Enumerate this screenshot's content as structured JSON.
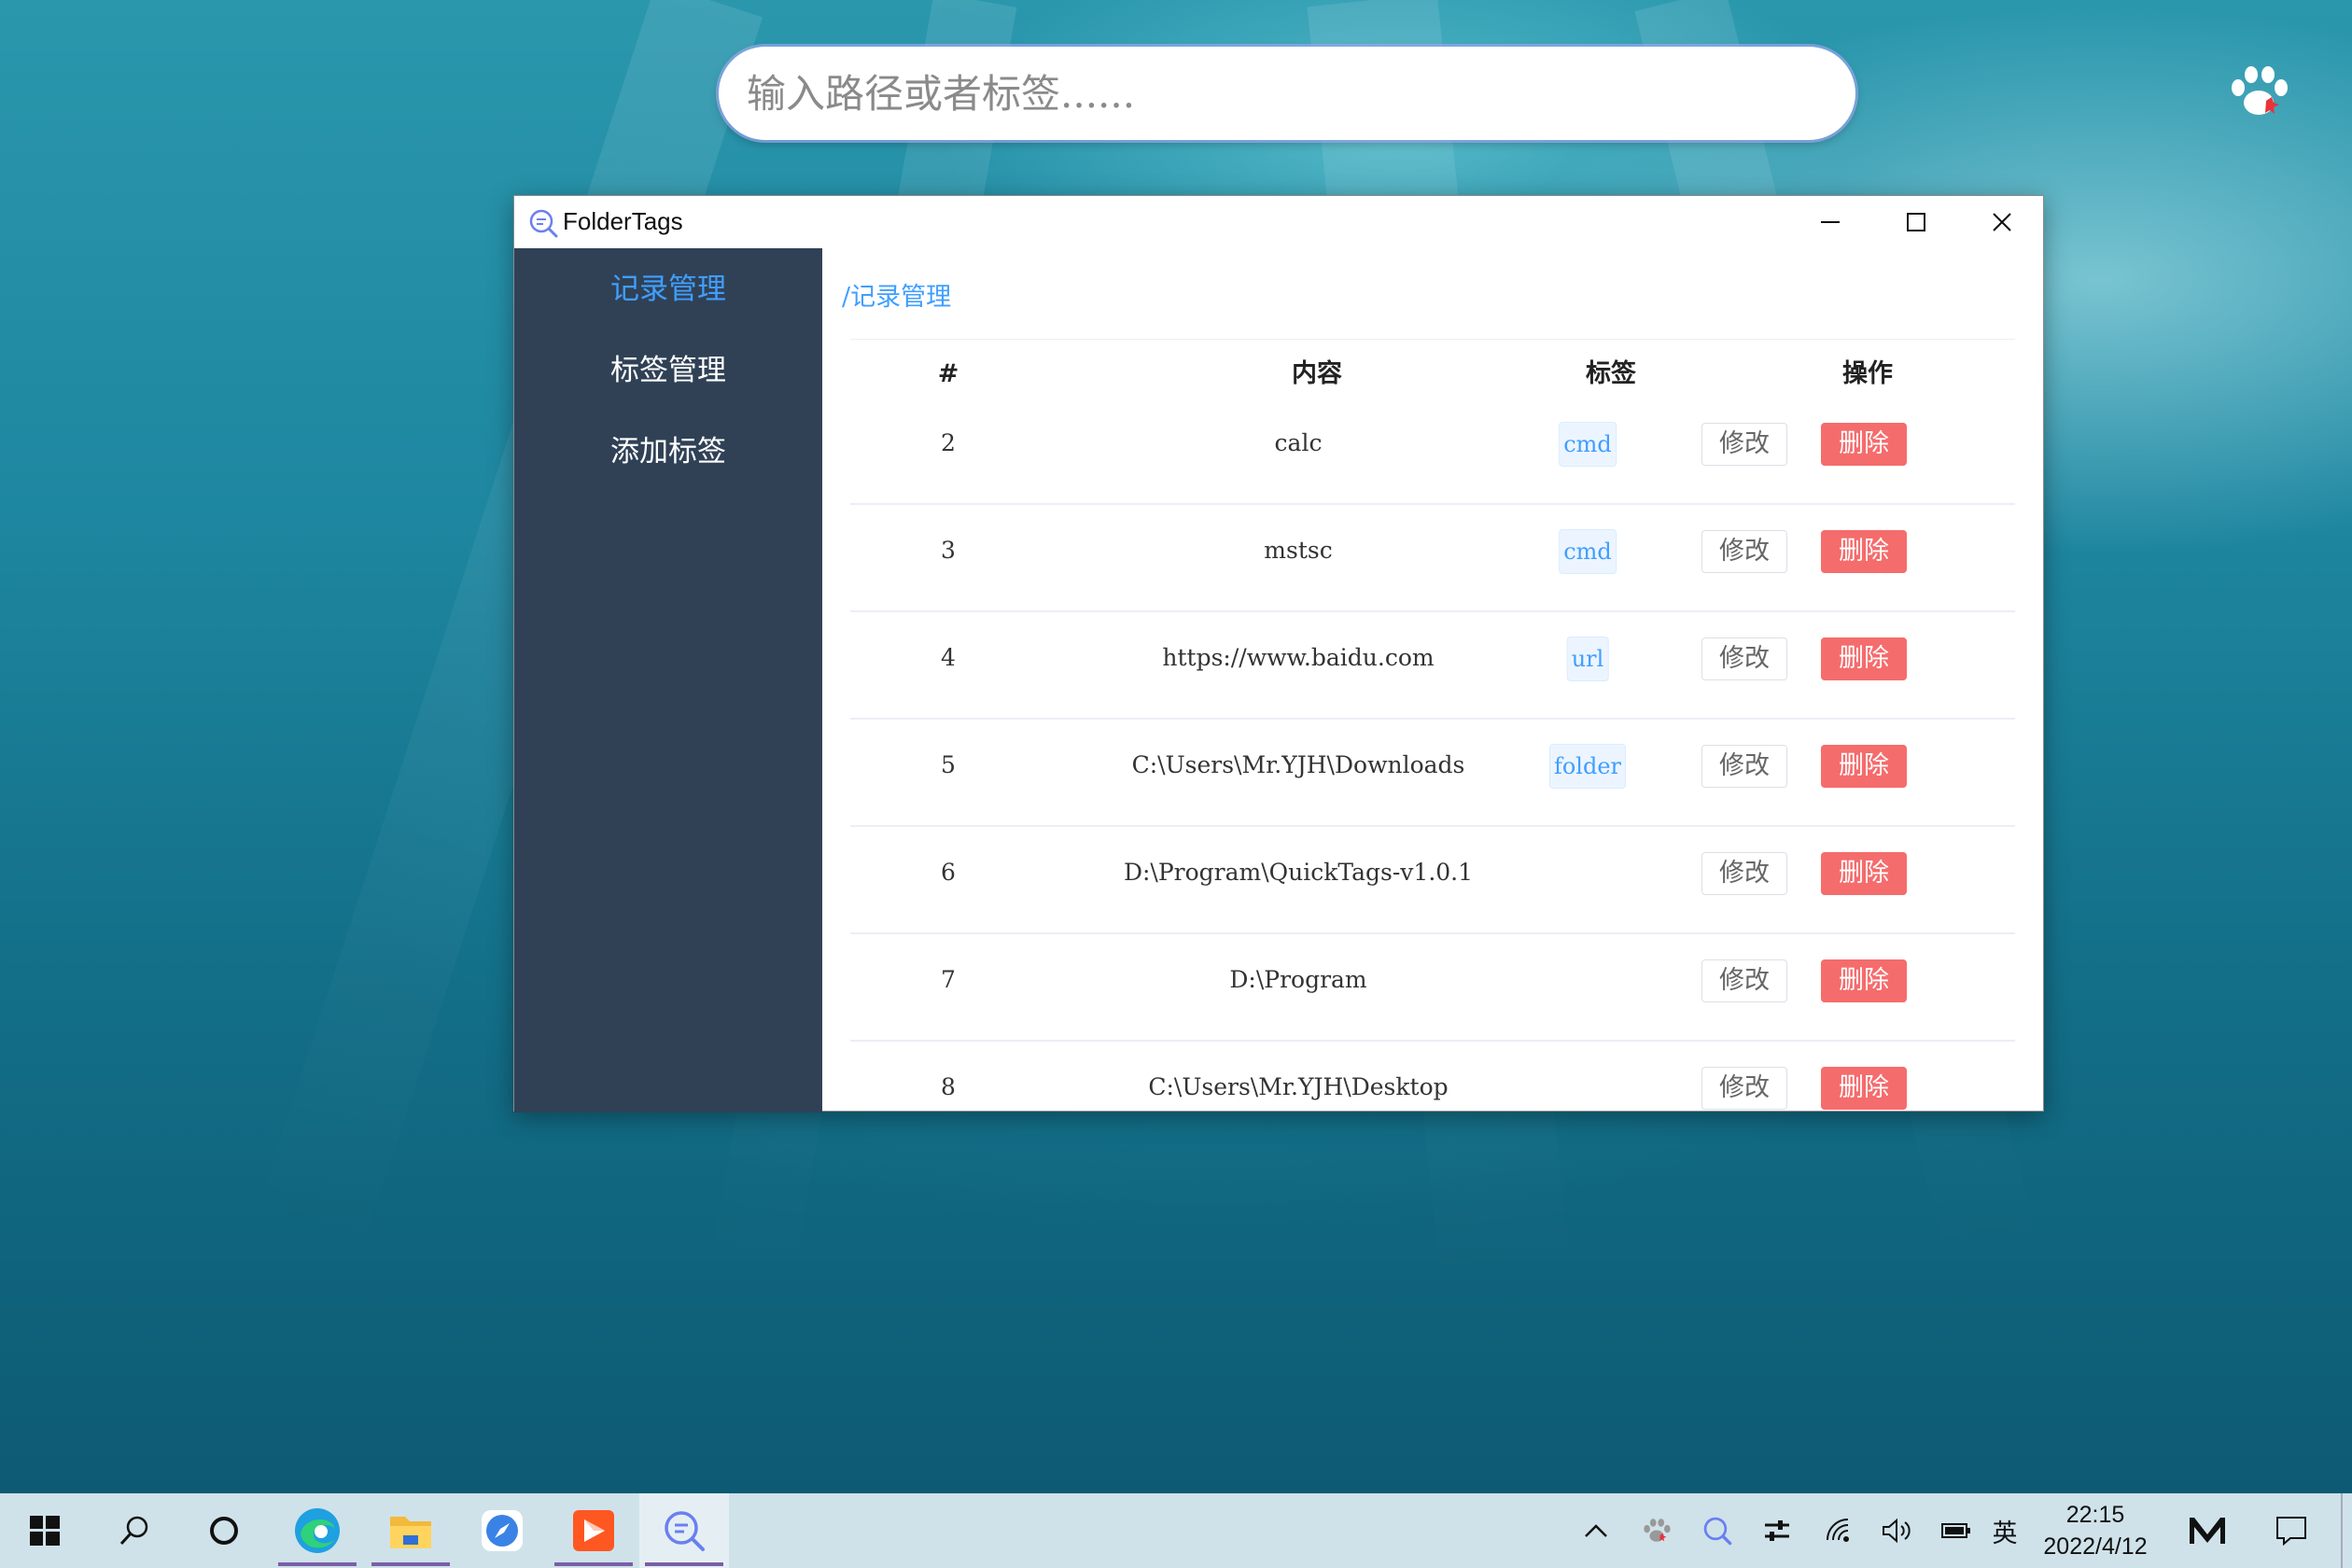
{
  "search": {
    "placeholder": "输入路径或者标签......"
  },
  "window": {
    "title": "FolderTags"
  },
  "sidebar": {
    "items": [
      {
        "label": "记录管理",
        "active": true
      },
      {
        "label": "标签管理",
        "active": false
      },
      {
        "label": "添加标签",
        "active": false
      }
    ]
  },
  "main": {
    "breadcrumb": "/记录管理",
    "table": {
      "columns": [
        "#",
        "内容",
        "标签",
        "操作"
      ],
      "rows": [
        {
          "id": "2",
          "content": "calc",
          "tag": "cmd"
        },
        {
          "id": "3",
          "content": "mstsc",
          "tag": "cmd"
        },
        {
          "id": "4",
          "content": "https://www.baidu.com",
          "tag": "url"
        },
        {
          "id": "5",
          "content": "C:\\Users\\Mr.YJH\\Downloads",
          "tag": "folder"
        },
        {
          "id": "6",
          "content": "D:\\Program\\QuickTags-v1.0.1",
          "tag": ""
        },
        {
          "id": "7",
          "content": "D:\\Program",
          "tag": ""
        },
        {
          "id": "8",
          "content": "C:\\Users\\Mr.YJH\\Desktop",
          "tag": ""
        }
      ],
      "edit_label": "修改",
      "delete_label": "删除"
    }
  },
  "taskbar": {
    "ime": "英",
    "time": "22:15",
    "date": "2022/4/12"
  },
  "colors": {
    "accent": "#409eff",
    "danger": "#f56c6c",
    "sidebar": "#304156"
  }
}
